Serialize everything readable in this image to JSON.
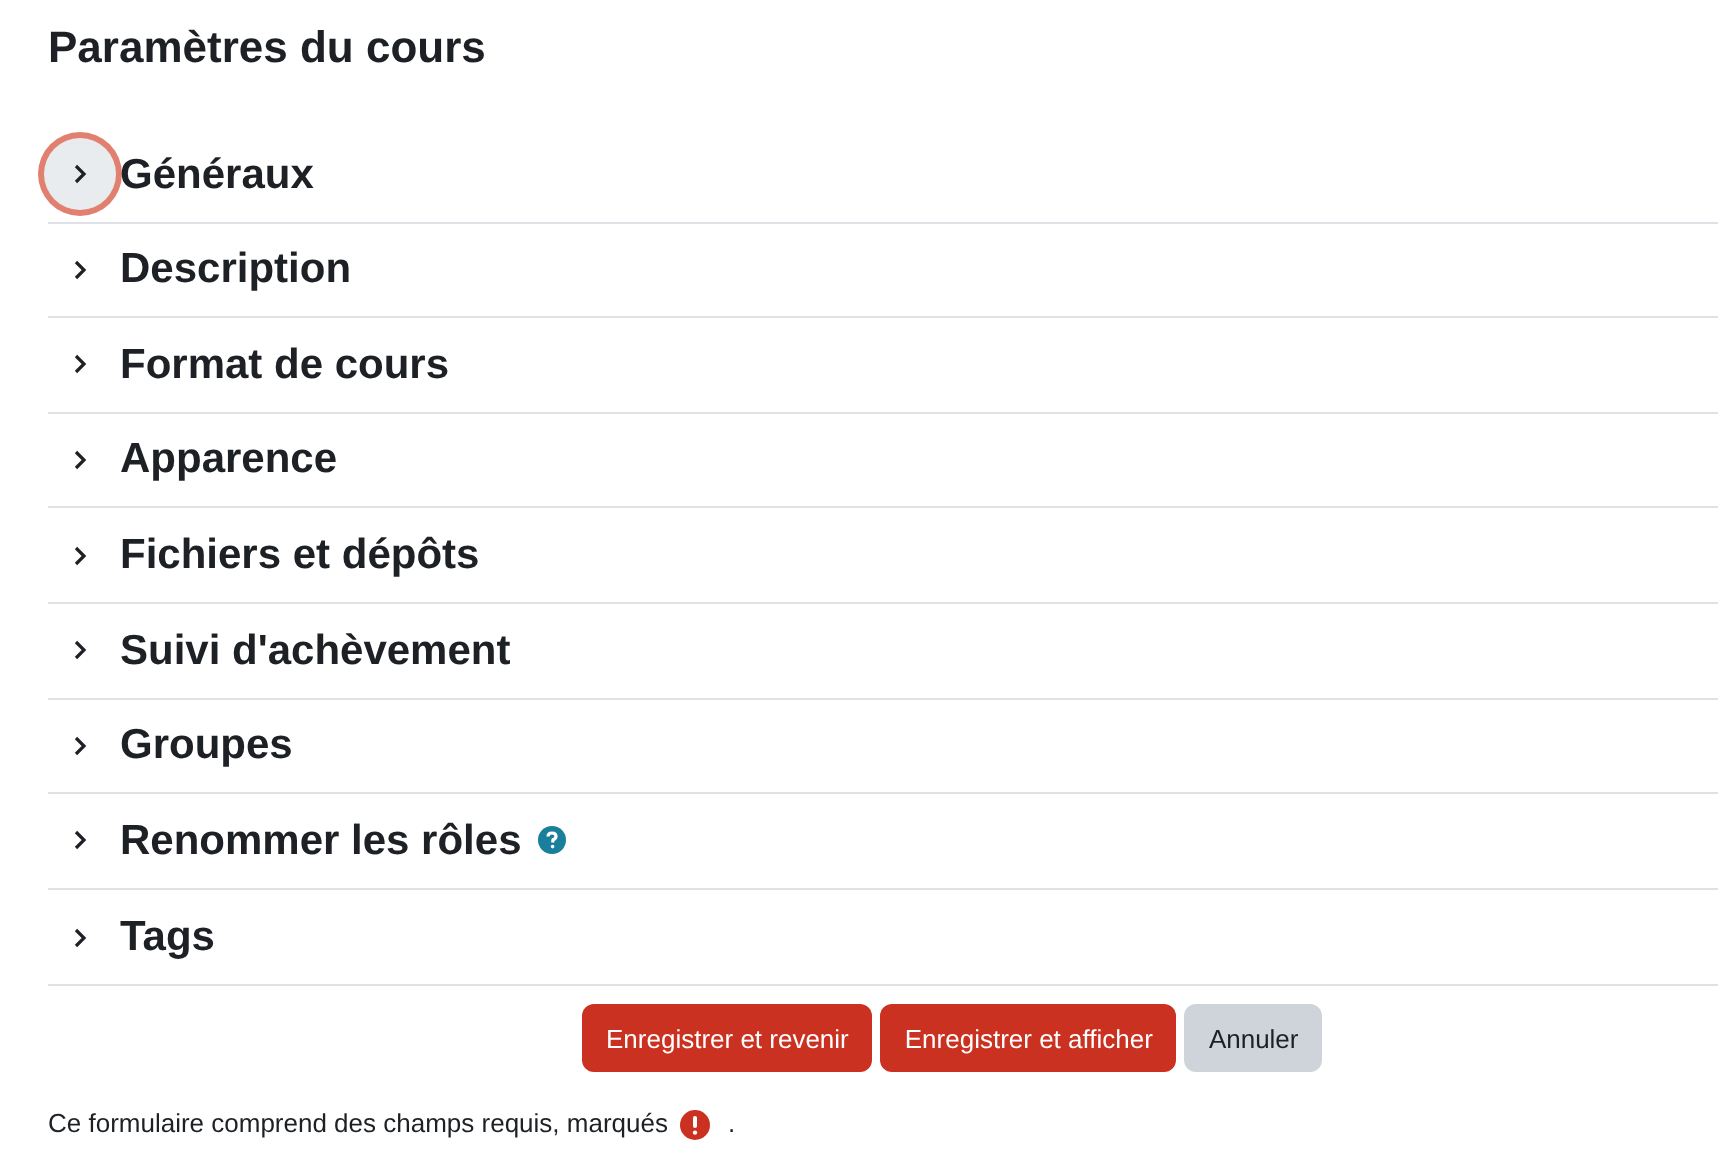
{
  "title": "Paramètres du cours",
  "sections": [
    {
      "label": "Généraux",
      "expanded": false,
      "focused": true,
      "help": false
    },
    {
      "label": "Description",
      "expanded": false,
      "focused": false,
      "help": false
    },
    {
      "label": "Format de cours",
      "expanded": false,
      "focused": false,
      "help": false
    },
    {
      "label": "Apparence",
      "expanded": false,
      "focused": false,
      "help": false
    },
    {
      "label": "Fichiers et dépôts",
      "expanded": false,
      "focused": false,
      "help": false
    },
    {
      "label": "Suivi d'achèvement",
      "expanded": false,
      "focused": false,
      "help": false
    },
    {
      "label": "Groupes",
      "expanded": false,
      "focused": false,
      "help": false
    },
    {
      "label": "Renommer les rôles",
      "expanded": false,
      "focused": false,
      "help": true
    },
    {
      "label": "Tags",
      "expanded": false,
      "focused": false,
      "help": false
    }
  ],
  "buttons": [
    {
      "label": "Enregistrer et revenir",
      "kind": "primary"
    },
    {
      "label": "Enregistrer et afficher",
      "kind": "primary"
    },
    {
      "label": "Annuler",
      "kind": "secondary"
    }
  ],
  "required_note": {
    "text": "Ce formulaire comprend des champs requis, marqués",
    "suffix": "."
  }
}
